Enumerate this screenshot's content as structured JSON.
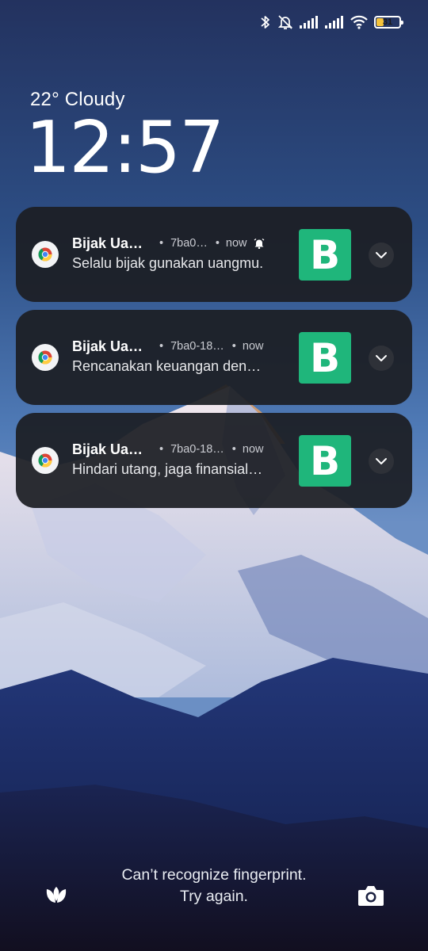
{
  "status_bar": {
    "icons": [
      "bluetooth-icon",
      "alarm-off-icon",
      "signal-icon",
      "signal-icon",
      "wifi-icon",
      "battery-icon"
    ],
    "battery_level": "31",
    "battery_color": "#f5c33b"
  },
  "lockscreen": {
    "weather": "22° Cloudy",
    "time": "12:57"
  },
  "notifications": [
    {
      "app_icon": "chrome-icon",
      "title": "Bijak Ua…",
      "url": "7ba0…",
      "time": "now",
      "has_alert_icon": true,
      "body": "Selalu bijak gunakan uangmu.",
      "thumb_letter": "B"
    },
    {
      "app_icon": "chrome-icon",
      "title": "Bijak Ua…",
      "url": "7ba0-18…",
      "time": "now",
      "has_alert_icon": false,
      "body": "Rencanakan keuangan den…",
      "thumb_letter": "B"
    },
    {
      "app_icon": "chrome-icon",
      "title": "Bijak Ua…",
      "url": "7ba0-18…",
      "time": "now",
      "has_alert_icon": false,
      "body": "Hindari utang, jaga finansial…",
      "thumb_letter": "B"
    }
  ],
  "separator": "•",
  "fingerprint": {
    "line1": "Can’t recognize fingerprint.",
    "line2": "Try again."
  },
  "shortcuts": {
    "left": "tulip-icon",
    "right": "camera-icon"
  },
  "colors": {
    "thumb_green": "#1fb67b",
    "card_bg": "#1c1e24"
  }
}
